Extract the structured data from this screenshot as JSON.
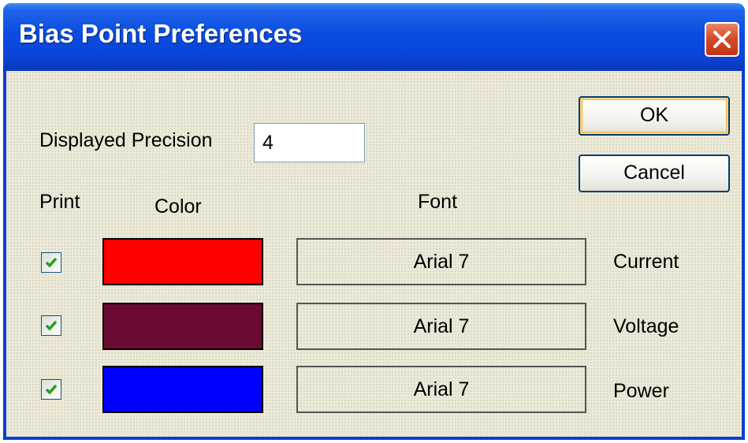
{
  "window": {
    "title": "Bias Point Preferences",
    "close_icon": "close-icon"
  },
  "precision": {
    "label": "Displayed Precision",
    "value": "4"
  },
  "buttons": {
    "ok_label": "OK",
    "cancel_label": "Cancel"
  },
  "headers": {
    "print": "Print",
    "color": "Color",
    "font": "Font"
  },
  "rows": [
    {
      "name": "Current",
      "print_checked": true,
      "color": "#ff0000",
      "font": "Arial 7"
    },
    {
      "name": "Voltage",
      "print_checked": true,
      "color": "#6b0a32",
      "font": "Arial 7"
    },
    {
      "name": "Power",
      "print_checked": true,
      "color": "#0000ff",
      "font": "Arial 7"
    }
  ],
  "colors": {
    "titlebar": "#0a44d6",
    "dialog_background": "#ece9d8",
    "checkmark": "#21a121"
  }
}
